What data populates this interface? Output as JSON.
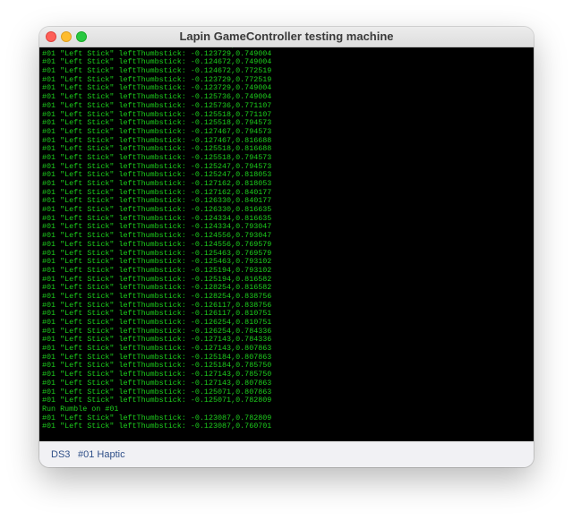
{
  "window": {
    "title": "Lapin GameController testing machine"
  },
  "console": {
    "lines": [
      "#01 \"Left Stick\" leftThumbstick: -0.123729,0.749004",
      "#01 \"Left Stick\" leftThumbstick: -0.123729,0.749004",
      "#01 \"Left Stick\" leftThumbstick: -0.124672,0.749004",
      "#01 \"Left Stick\" leftThumbstick: -0.124672,0.772519",
      "#01 \"Left Stick\" leftThumbstick: -0.123729,0.772519",
      "#01 \"Left Stick\" leftThumbstick: -0.123729,0.749004",
      "#01 \"Left Stick\" leftThumbstick: -0.125736,0.749004",
      "#01 \"Left Stick\" leftThumbstick: -0.125736,0.771107",
      "#01 \"Left Stick\" leftThumbstick: -0.125518,0.771107",
      "#01 \"Left Stick\" leftThumbstick: -0.125518,0.794573",
      "#01 \"Left Stick\" leftThumbstick: -0.127467,0.794573",
      "#01 \"Left Stick\" leftThumbstick: -0.127467,0.816688",
      "#01 \"Left Stick\" leftThumbstick: -0.125518,0.816688",
      "#01 \"Left Stick\" leftThumbstick: -0.125518,0.794573",
      "#01 \"Left Stick\" leftThumbstick: -0.125247,0.794573",
      "#01 \"Left Stick\" leftThumbstick: -0.125247,0.818053",
      "#01 \"Left Stick\" leftThumbstick: -0.127162,0.818053",
      "#01 \"Left Stick\" leftThumbstick: -0.127162,0.840177",
      "#01 \"Left Stick\" leftThumbstick: -0.126330,0.840177",
      "#01 \"Left Stick\" leftThumbstick: -0.126330,0.816635",
      "#01 \"Left Stick\" leftThumbstick: -0.124334,0.816635",
      "#01 \"Left Stick\" leftThumbstick: -0.124334,0.793047",
      "#01 \"Left Stick\" leftThumbstick: -0.124556,0.793047",
      "#01 \"Left Stick\" leftThumbstick: -0.124556,0.769579",
      "#01 \"Left Stick\" leftThumbstick: -0.125463,0.769579",
      "#01 \"Left Stick\" leftThumbstick: -0.125463,0.793102",
      "#01 \"Left Stick\" leftThumbstick: -0.125194,0.793102",
      "#01 \"Left Stick\" leftThumbstick: -0.125194,0.816582",
      "#01 \"Left Stick\" leftThumbstick: -0.128254,0.816582",
      "#01 \"Left Stick\" leftThumbstick: -0.128254,0.838756",
      "#01 \"Left Stick\" leftThumbstick: -0.126117,0.838756",
      "#01 \"Left Stick\" leftThumbstick: -0.126117,0.810751",
      "#01 \"Left Stick\" leftThumbstick: -0.126254,0.810751",
      "#01 \"Left Stick\" leftThumbstick: -0.126254,0.784336",
      "#01 \"Left Stick\" leftThumbstick: -0.127143,0.784336",
      "#01 \"Left Stick\" leftThumbstick: -0.127143,0.807863",
      "#01 \"Left Stick\" leftThumbstick: -0.125184,0.807863",
      "#01 \"Left Stick\" leftThumbstick: -0.125184,0.785750",
      "#01 \"Left Stick\" leftThumbstick: -0.127143,0.785750",
      "#01 \"Left Stick\" leftThumbstick: -0.127143,0.807863",
      "#01 \"Left Stick\" leftThumbstick: -0.125071,0.807863",
      "#01 \"Left Stick\" leftThumbstick: -0.125071,0.782809",
      "Run Rumble on #01",
      "#01 \"Left Stick\" leftThumbstick: -0.123087,0.782809",
      "#01 \"Left Stick\" leftThumbstick: -0.123087,0.760701"
    ]
  },
  "statusbar": {
    "controller_label": "DS3",
    "haptic_label": "#01 Haptic"
  }
}
